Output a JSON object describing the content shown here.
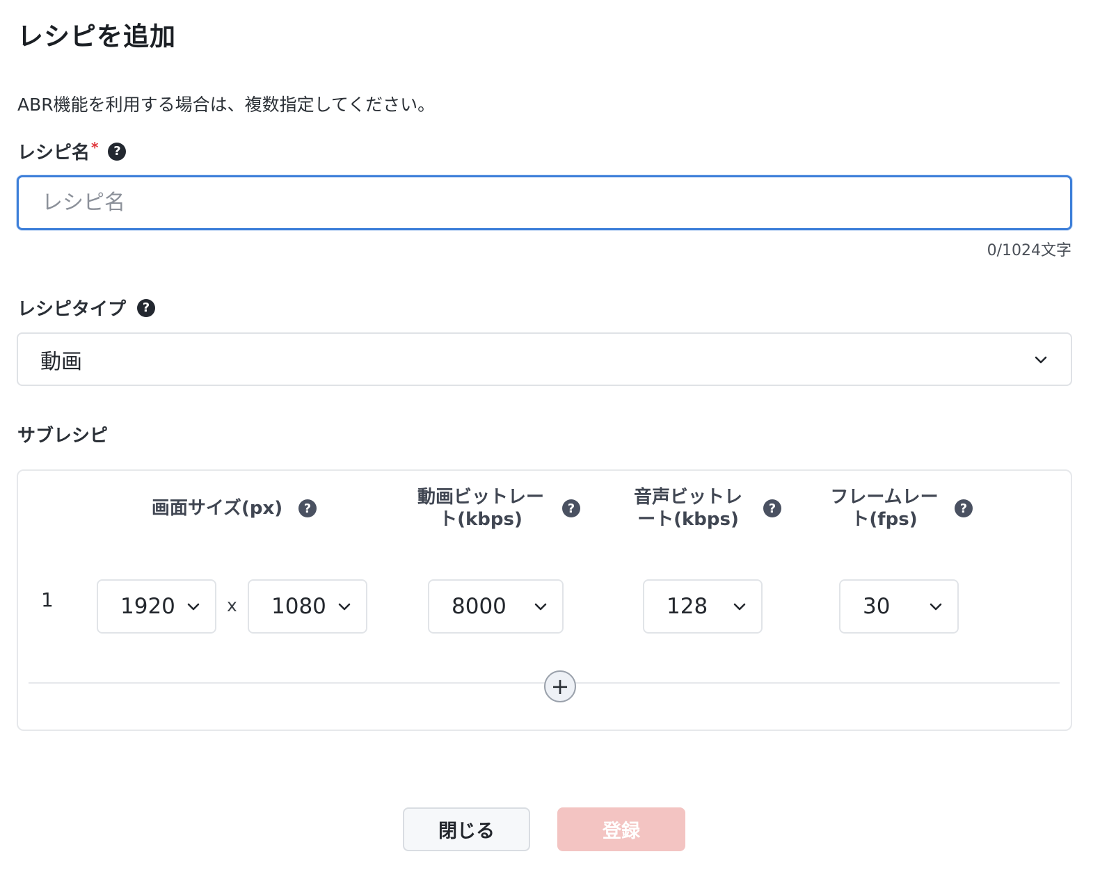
{
  "dialog": {
    "title": "レシピを追加",
    "description": "ABR機能を利用する場合は、複数指定してください。"
  },
  "recipe_name": {
    "label": "レシピ名",
    "required_mark": "*",
    "help_icon": "question-circle-icon",
    "help_glyph": "?",
    "placeholder": "レシピ名",
    "value": "",
    "counter": "0/1024文字"
  },
  "recipe_type": {
    "label": "レシピタイプ",
    "help_icon": "question-circle-icon",
    "help_glyph": "?",
    "selected": "動画"
  },
  "sub_recipe": {
    "label": "サブレシピ",
    "columns": [
      {
        "label": "画面サイズ(px)",
        "help_glyph": "?"
      },
      {
        "label": "動画ビットレート(kbps)",
        "line1": "動画ビットレー",
        "line2": "ト(kbps)",
        "help_glyph": "?"
      },
      {
        "label": "音声ビットレート(kbps)",
        "line1": "音声ビットレ",
        "line2": "ート(kbps)",
        "help_glyph": "?"
      },
      {
        "label": "フレームレート(fps)",
        "line1": "フレームレー",
        "line2": "ト(fps)",
        "help_glyph": "?"
      }
    ],
    "rows": [
      {
        "index": "1",
        "width": "1920",
        "separator": "x",
        "height": "1080",
        "video_bitrate": "8000",
        "audio_bitrate": "128",
        "frame_rate": "30"
      }
    ],
    "add_glyph": "+"
  },
  "buttons": {
    "close": "閉じる",
    "submit": "登録"
  },
  "colors": {
    "focus_border": "#3d7fd9",
    "required": "#e0393e",
    "submit_disabled_bg": "#f3c4c2"
  }
}
